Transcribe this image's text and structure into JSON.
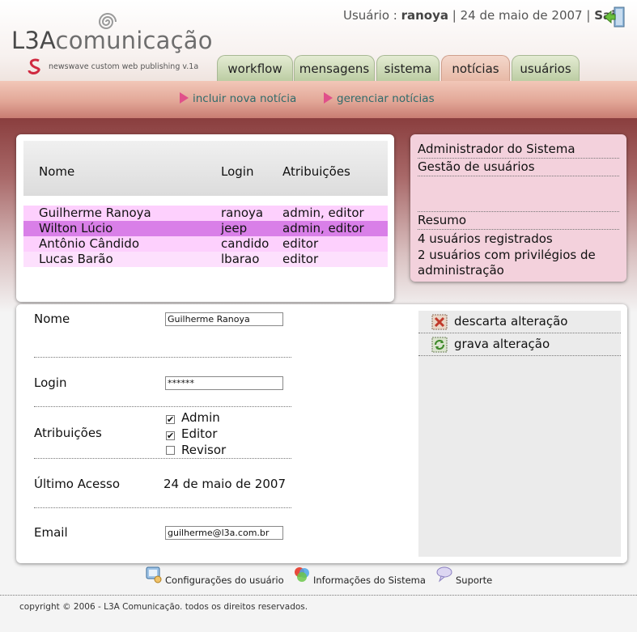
{
  "header": {
    "logo_prefix": "L3A",
    "logo_suffix": "comunicação",
    "tagline": "newswave custom web publishing v.1a",
    "user_label": "Usuário : ",
    "user_name": "ranoya",
    "date_text": " | 24 de maio de 2007 | ",
    "logout_label": "Sair"
  },
  "tabs": [
    {
      "label": "workflow",
      "active": false
    },
    {
      "label": "mensagens",
      "active": false
    },
    {
      "label": "sistema",
      "active": false
    },
    {
      "label": "notícias",
      "active": true
    },
    {
      "label": "usuários",
      "active": false
    }
  ],
  "subnav": {
    "new_news": "incluir nova notícia",
    "manage_news": "gerenciar notícias"
  },
  "user_table": {
    "headers": {
      "name": "Nome",
      "login": "Login",
      "roles": "Atribuições"
    },
    "rows": [
      {
        "name": "Guilherme Ranoya",
        "login": "ranoya",
        "roles": "admin, editor",
        "color": "#fdd0fd"
      },
      {
        "name": "Wilton Lúcio",
        "login": "jeep",
        "roles": "admin, editor",
        "color": "#d97fe8"
      },
      {
        "name": "Antônio Cândido",
        "login": "candido",
        "roles": "editor",
        "color": "#fdd0fd"
      },
      {
        "name": "Lucas Barão",
        "login": "lbarao",
        "roles": "editor",
        "color": "#fde0fd"
      }
    ]
  },
  "summary": {
    "line1": "Administrador do Sistema",
    "line2": "Gestão de usuários",
    "heading": "Resumo",
    "registered": "4 usuários registrados",
    "admins": "2 usuários com privilégios de administração"
  },
  "form": {
    "name_label": "Nome",
    "name_value": "Guilherme Ranoya",
    "login_label": "Login",
    "password_value": "******",
    "roles_label": "Atribuições",
    "role_admin": "Admin",
    "role_editor": "Editor",
    "role_reviewer": "Revisor",
    "role_admin_checked": true,
    "role_editor_checked": true,
    "role_reviewer_checked": false,
    "last_access_label": "Último Acesso",
    "last_access_value": "24 de maio de 2007",
    "email_label": "Email",
    "email_value": "guilherme@l3a.com.br"
  },
  "actions": {
    "discard": "descarta alteração",
    "save": "grava alteração"
  },
  "footer": {
    "user_settings": "Configurações do usuário",
    "system_info": "Informações do Sistema",
    "support": "Suporte",
    "copyright": "copyright © 2006 - L3A Comunicação. todos os direitos reservados."
  },
  "colors": {
    "active_tab": "#e7b9a6",
    "tab": "#bccda3",
    "selected_row": "#d97fe8",
    "row": "#fdd0fd",
    "summary_bg": "#f3d1dc",
    "link": "#2f6b6b",
    "arrow": "#e0508a"
  }
}
